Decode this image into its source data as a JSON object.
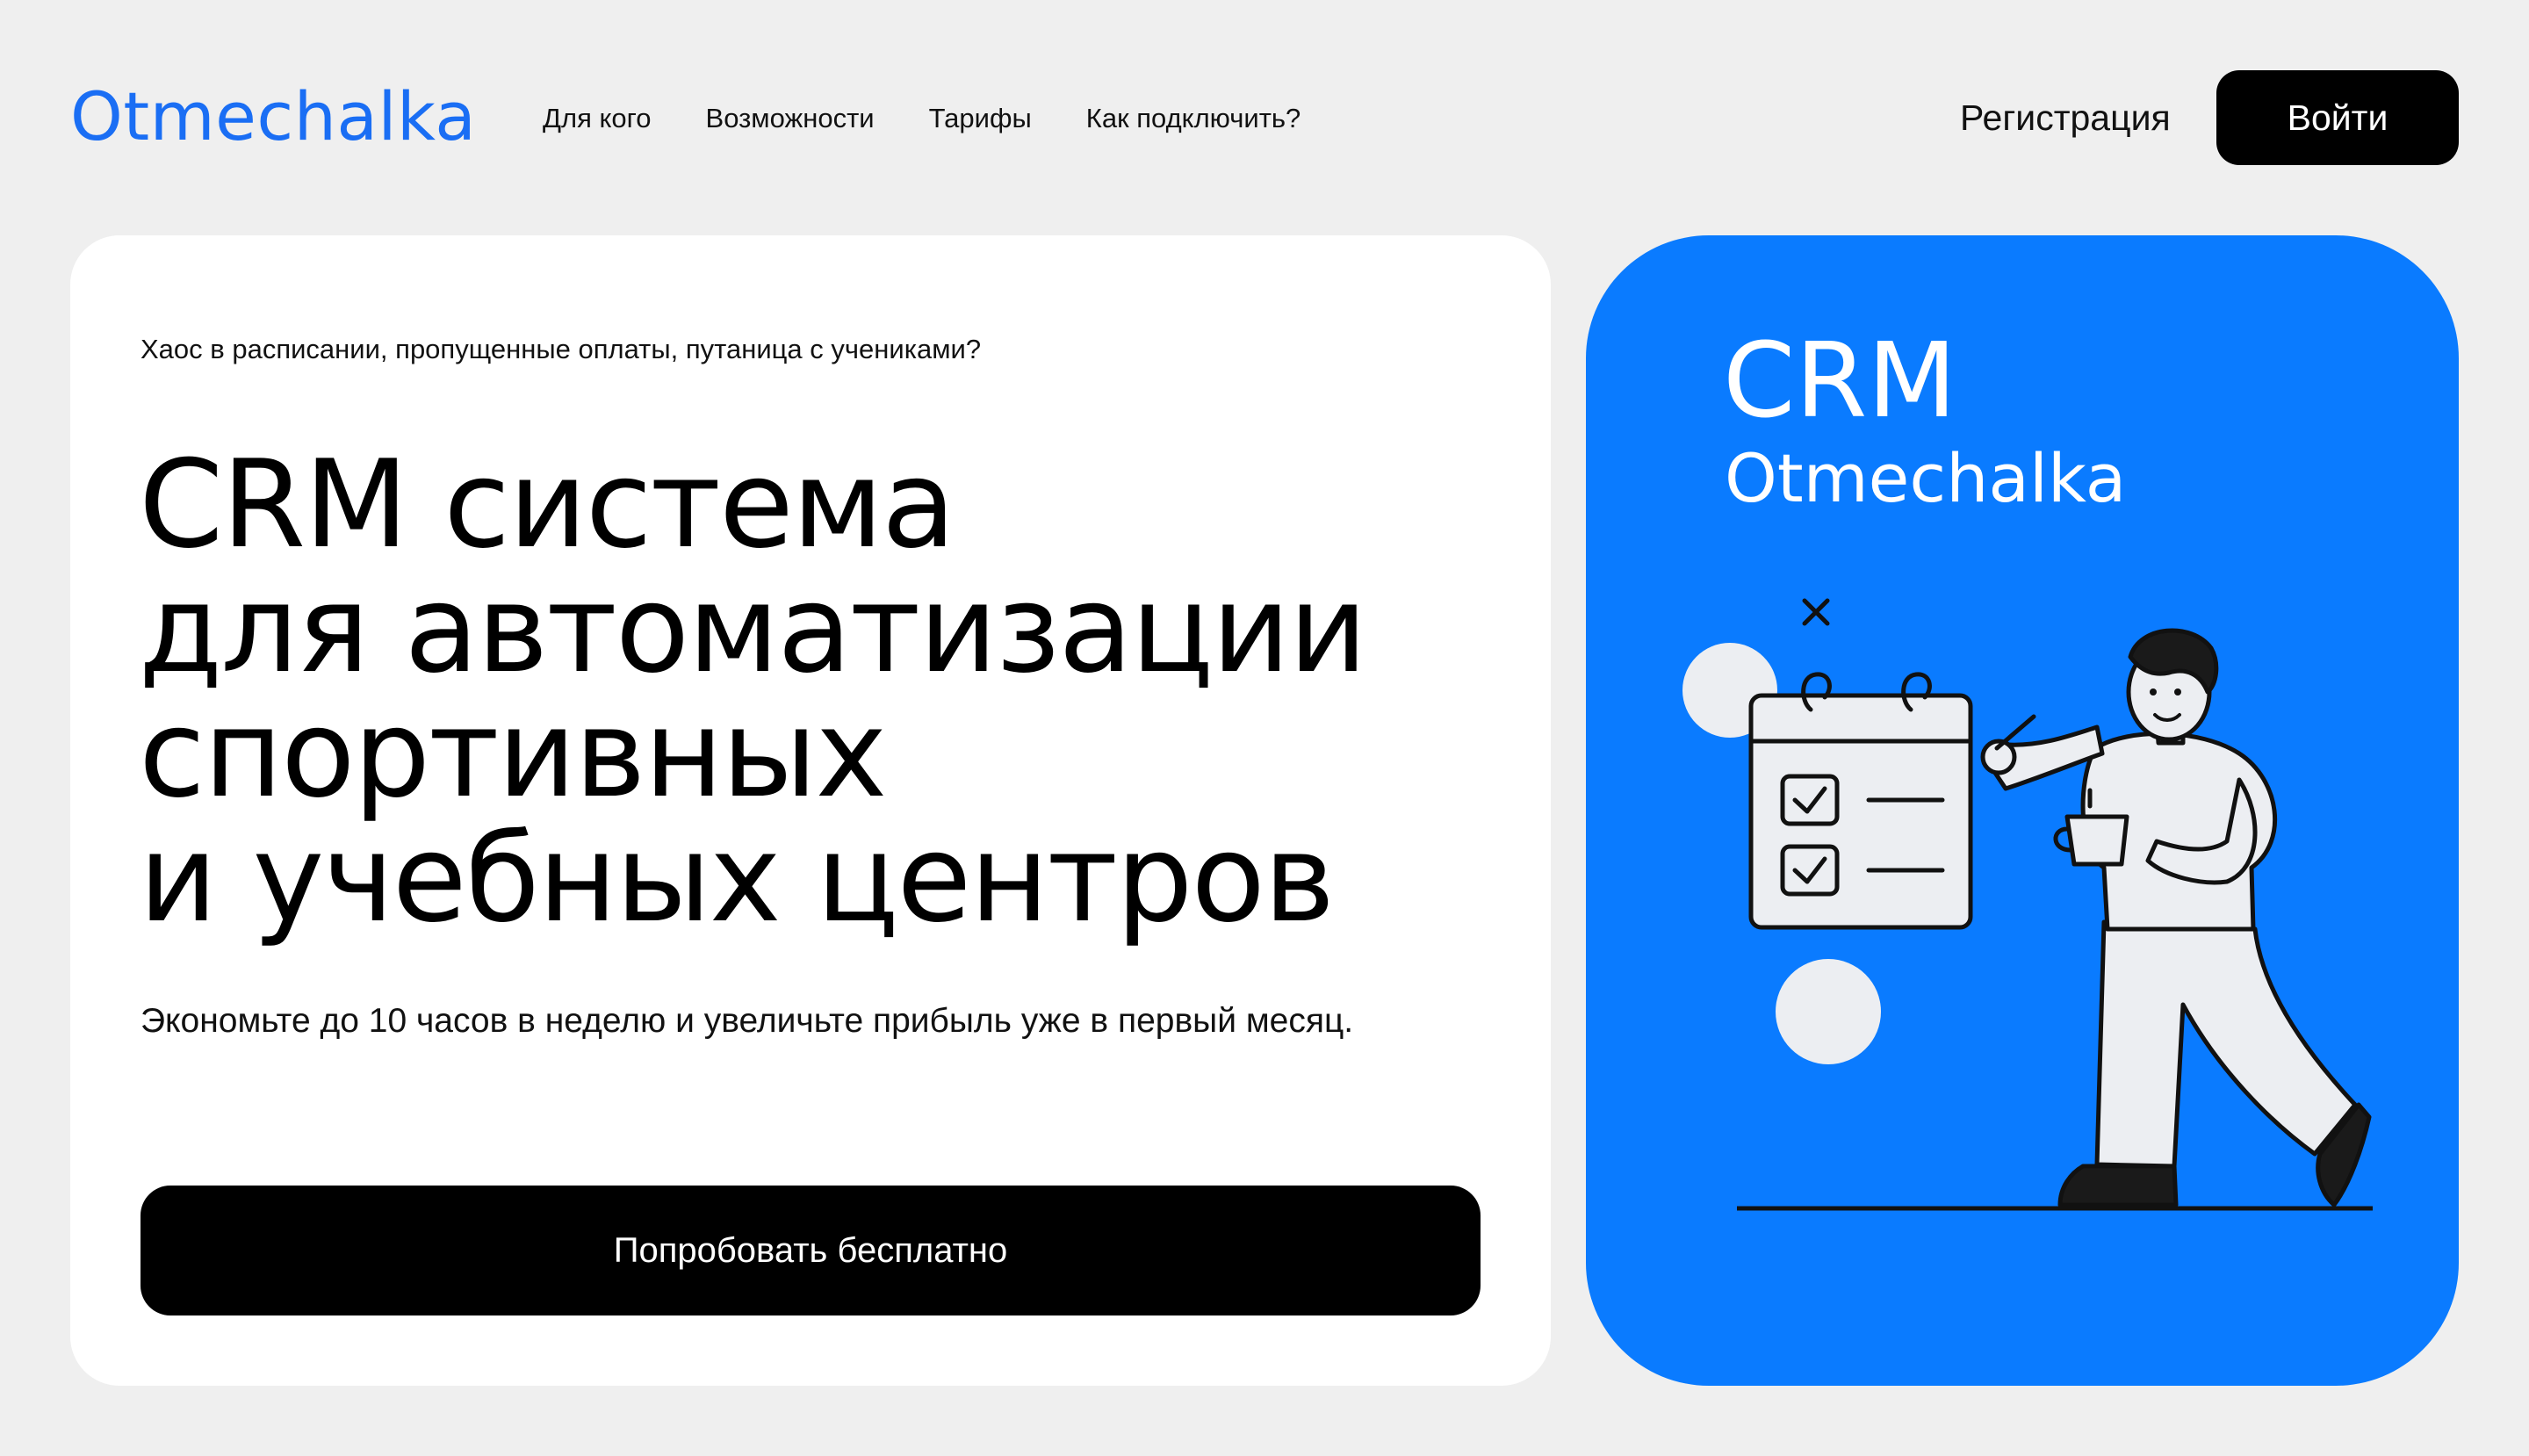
{
  "header": {
    "logo": "Otmechalka",
    "nav": [
      {
        "label": "Для кого"
      },
      {
        "label": "Возможности"
      },
      {
        "label": "Тарифы"
      },
      {
        "label": "Как подключить?"
      }
    ],
    "register_label": "Регистрация",
    "login_label": "Войти"
  },
  "hero": {
    "eyebrow": "Хаос в расписании, пропущенные оплаты, путаница с учениками?",
    "headline_lines": [
      "CRM система",
      "для автоматизации",
      "спортивных",
      "и учебных центров"
    ],
    "subtext": "Экономьте до 10 часов в неделю и увеличьте прибыль уже в первый месяц.",
    "cta_label": "Попробовать бесплатно"
  },
  "promo": {
    "title": "CRM",
    "subtitle": "Otmechalka",
    "illustration_icon": "person-with-calendar-checklist-illustration"
  },
  "colors": {
    "brand_blue": "#1a6ef4",
    "promo_blue": "#0a7bff",
    "page_bg": "#efefef",
    "card_bg": "#ffffff",
    "button_bg": "#000000"
  }
}
